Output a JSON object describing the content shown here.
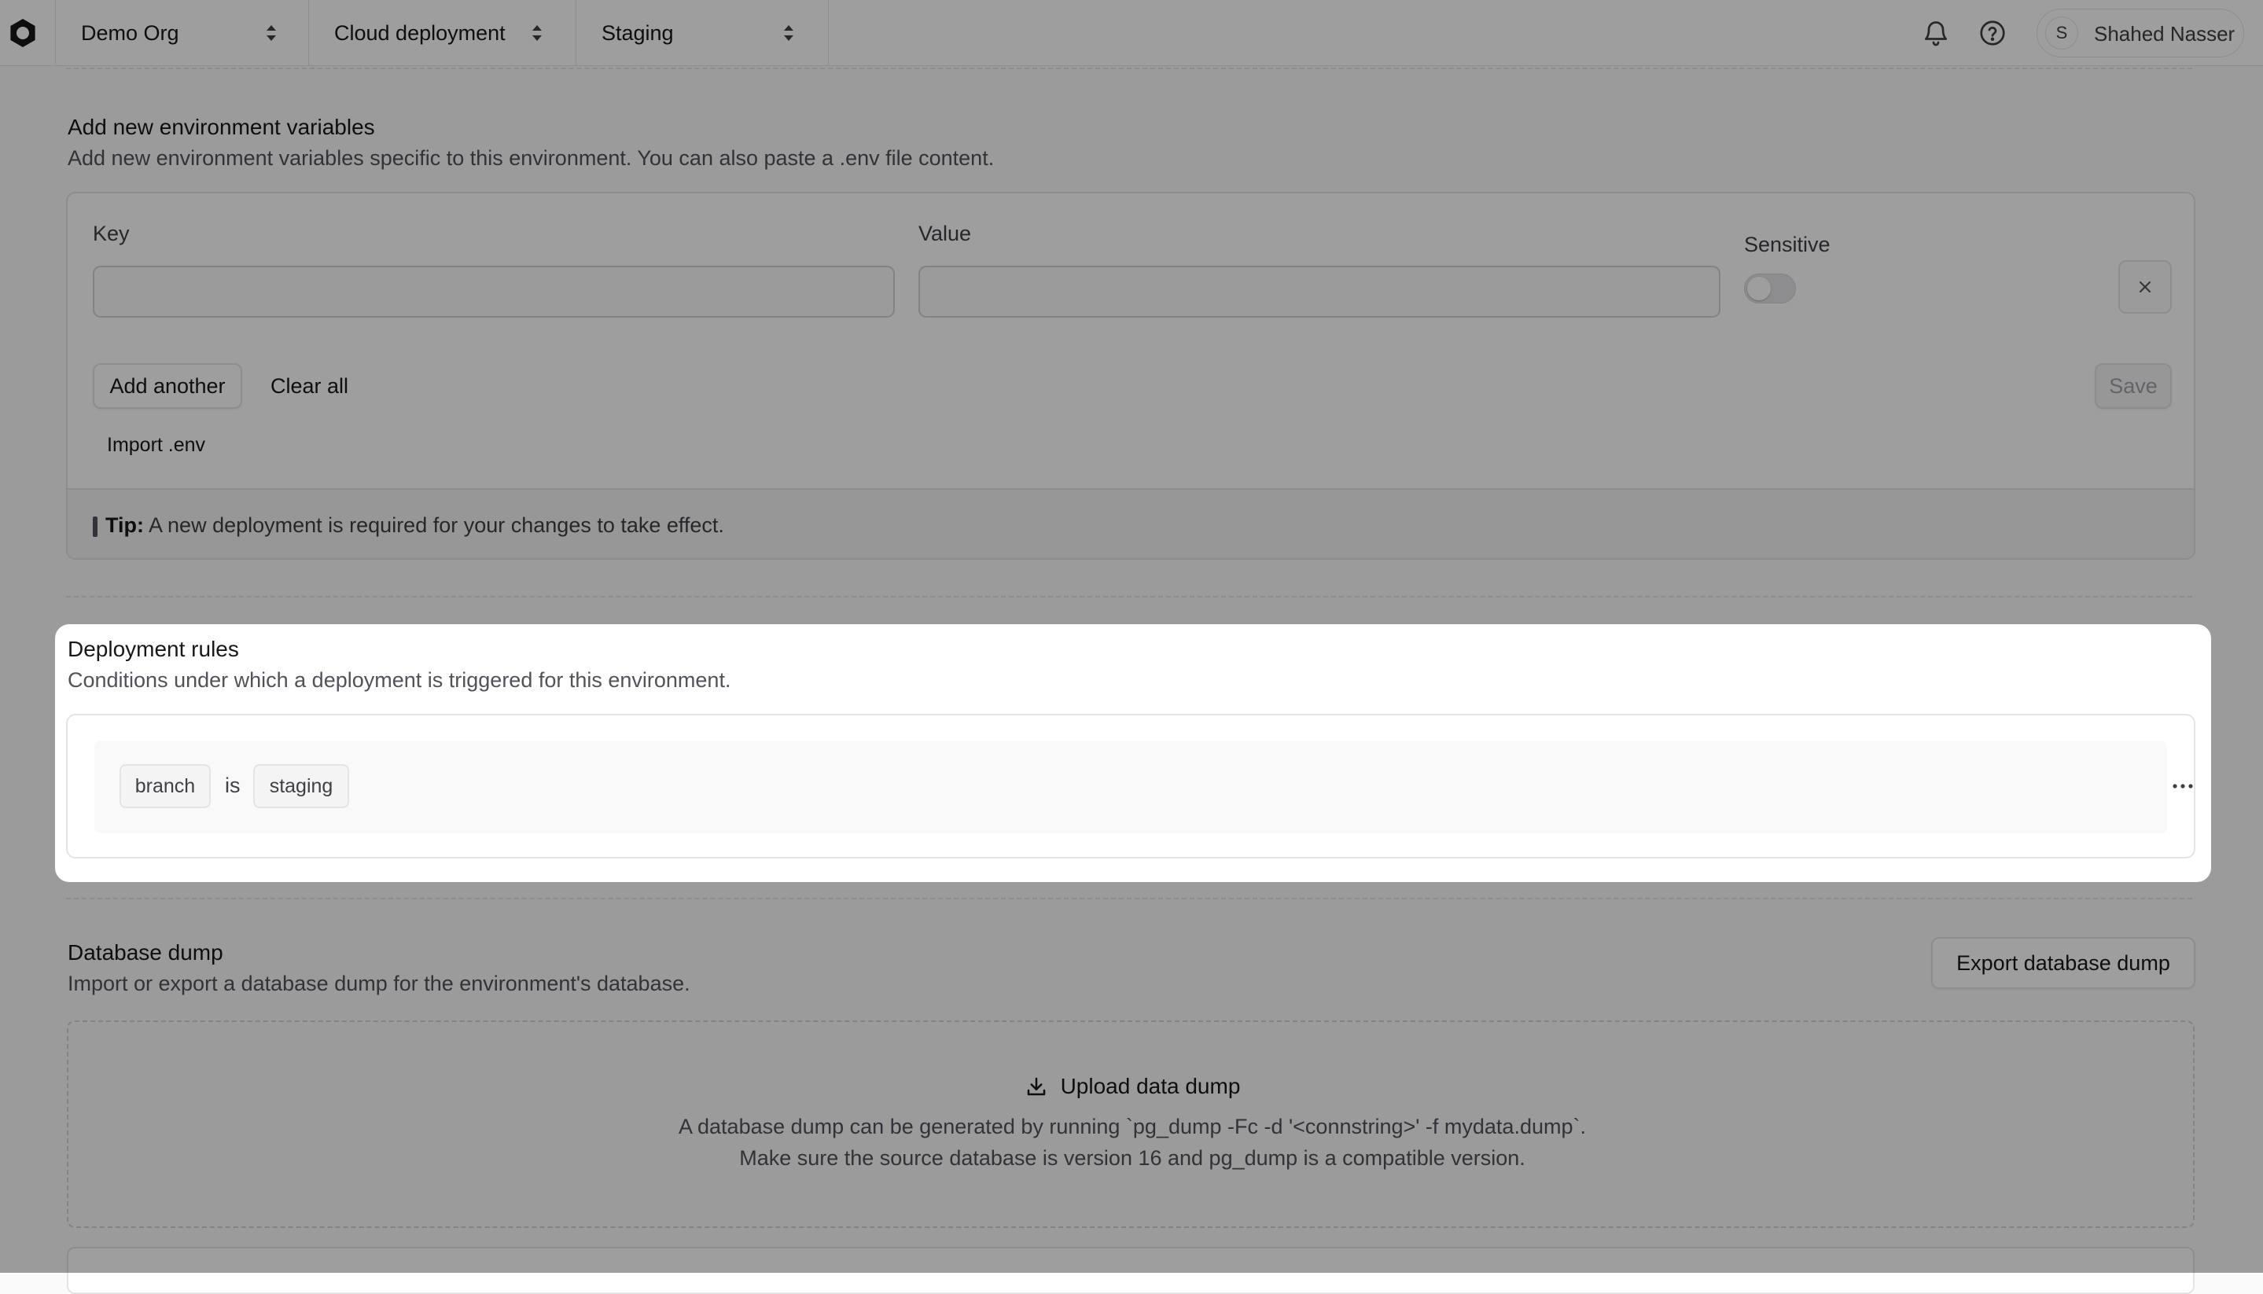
{
  "topbar": {
    "org": "Demo Org",
    "project": "Cloud deployment",
    "environment": "Staging",
    "user_initial": "S",
    "user_name": "Shahed Nasser"
  },
  "env_vars": {
    "title": "Add new environment variables",
    "description": "Add new environment variables specific to this environment. You can also paste a .env file content.",
    "key_label": "Key",
    "value_label": "Value",
    "sensitive_label": "Sensitive",
    "sensitive_on": false,
    "add_another": "Add another",
    "clear_all": "Clear all",
    "save": "Save",
    "import_env": "Import .env",
    "tip_label": "Tip:",
    "tip_text": " A new deployment is required for your changes to take effect."
  },
  "deployment_rules": {
    "title": "Deployment rules",
    "description": "Conditions under which a deployment is triggered for this environment.",
    "rule": {
      "field": "branch",
      "operator": "is",
      "value": "staging"
    }
  },
  "database_dump": {
    "title": "Database dump",
    "description": "Import or export a database dump for the environment's database.",
    "export_button": "Export database dump",
    "upload_title": "Upload data dump",
    "upload_line1": "A database dump can be generated by running `pg_dump -Fc -d '<connstring>' -f mydata.dump`.",
    "upload_line2": "Make sure the source database is version 16 and pg_dump is a compatible version."
  },
  "icons": {
    "logo": "logo-icon",
    "notifications": "bell-icon",
    "help": "help-circle-icon",
    "remove": "close-icon",
    "more": "more-horizontal-icon",
    "upload": "download-icon"
  }
}
